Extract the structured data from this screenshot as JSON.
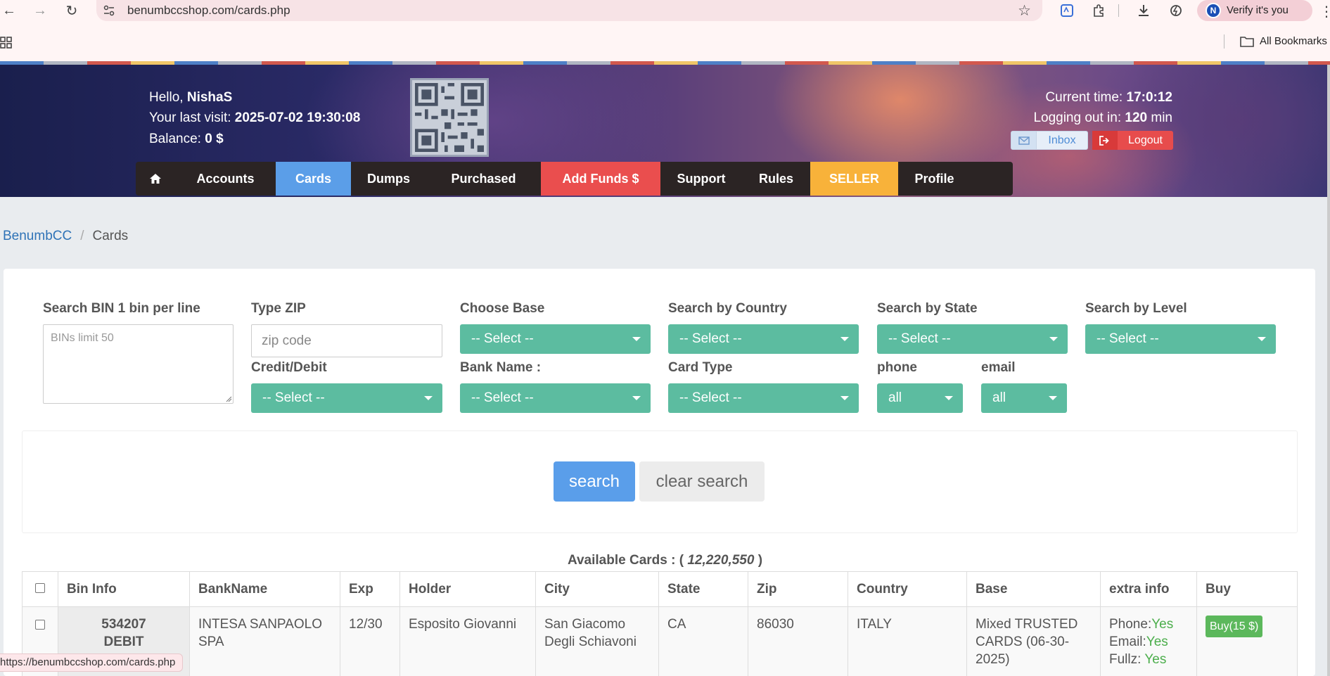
{
  "browser": {
    "url": "benumbccshop.com/cards.php",
    "verify_label": "Verify it's you",
    "avatar_letter": "N",
    "bookmarks_label": "All Bookmarks",
    "status_url": "https://benumbccshop.com/cards.php"
  },
  "header": {
    "hello_prefix": "Hello,",
    "username": "NishaS",
    "last_visit_label": "Your last visit:",
    "last_visit_value": "2025-07-02 19:30:08",
    "balance_label": "Balance:",
    "balance_value": "0 $",
    "current_time_label": "Current time:",
    "current_time_value": "17:0:12",
    "logout_in_label": "Logging out in:",
    "logout_in_value": "120",
    "logout_in_unit": "min",
    "inbox_label": "Inbox",
    "logout_label": "Logout"
  },
  "nav": {
    "accounts": "Accounts",
    "cards": "Cards",
    "dumps": "Dumps",
    "purchased": "Purchased",
    "add_funds": "Add Funds $",
    "support": "Support",
    "rules": "Rules",
    "seller": "SELLER",
    "profile": "Profile"
  },
  "breadcrumb": {
    "root": "BenumbCC",
    "sep": "/",
    "current": "Cards"
  },
  "filters": {
    "bin_label": "Search BIN 1 bin per line",
    "bin_placeholder": "BINs limit 50",
    "zip_label": "Type ZIP",
    "zip_placeholder": "zip code",
    "base_label": "Choose Base",
    "country_label": "Search by Country",
    "state_label": "Search by State",
    "level_label": "Search by Level",
    "credit_label": "Credit/Debit",
    "bank_label": "Bank Name :",
    "cardtype_label": "Card Type",
    "phone_label": "phone",
    "email_label": "email",
    "select_default": "-- Select --",
    "phone_value": "all",
    "email_value": "all"
  },
  "actions": {
    "search": "search",
    "clear": "clear search"
  },
  "available": {
    "label": "Available Cards : (",
    "count": "12,220,550",
    "close": ")"
  },
  "table": {
    "columns": [
      "Bin Info",
      "BankName",
      "Exp",
      "Holder",
      "City",
      "State",
      "Zip",
      "Country",
      "Base",
      "extra info",
      "Buy"
    ],
    "rows": [
      {
        "bin": "534207",
        "type": "DEBIT",
        "bank": "INTESA SANPAOLO SPA",
        "exp": "12/30",
        "holder": "Esposito Giovanni",
        "city": "San Giacomo Degli Schiavoni",
        "state": "CA",
        "zip": "86030",
        "country": "ITALY",
        "base": "Mixed TRUSTED CARDS (06-30-2025)",
        "phone_label": "Phone:",
        "phone_value": "Yes",
        "email_label": "Email:",
        "email_value": "Yes",
        "fullz_label": "Fullz:",
        "fullz_value": "Yes",
        "buy": "Buy(15 $)"
      }
    ]
  }
}
